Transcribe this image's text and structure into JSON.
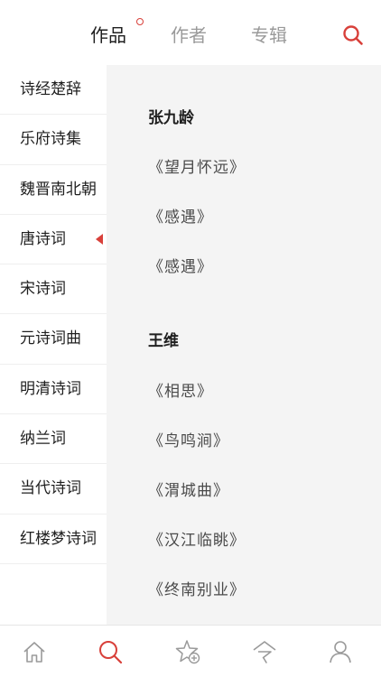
{
  "header": {
    "tabs": [
      {
        "label": "作品",
        "active": true,
        "has_dot": true
      },
      {
        "label": "作者",
        "active": false
      },
      {
        "label": "专辑",
        "active": false
      }
    ],
    "search_icon": "search-icon",
    "accent_color": "#d8403a"
  },
  "sidebar": {
    "items": [
      {
        "label": "诗经楚辞"
      },
      {
        "label": "乐府诗集"
      },
      {
        "label": "魏晋南北朝"
      },
      {
        "label": "唐诗词",
        "selected": true
      },
      {
        "label": "宋诗词"
      },
      {
        "label": "元诗词曲"
      },
      {
        "label": "明清诗词"
      },
      {
        "label": "纳兰词"
      },
      {
        "label": "当代诗词"
      },
      {
        "label": "红楼梦诗词"
      }
    ]
  },
  "content": {
    "groups": [
      {
        "author": "张九龄",
        "works": [
          "《望月怀远》",
          "《感遇》",
          "《感遇》"
        ]
      },
      {
        "author": "王维",
        "works": [
          "《相思》",
          "《鸟鸣涧》",
          "《渭城曲》",
          "《汉江临眺》",
          "《终南别业》"
        ]
      }
    ]
  },
  "bottom_nav": {
    "items": [
      {
        "icon": "home-icon",
        "active": false
      },
      {
        "icon": "search-icon",
        "active": true
      },
      {
        "icon": "star-add-icon",
        "active": false
      },
      {
        "icon": "poem-icon",
        "active": false
      },
      {
        "icon": "user-icon",
        "active": false
      }
    ]
  }
}
